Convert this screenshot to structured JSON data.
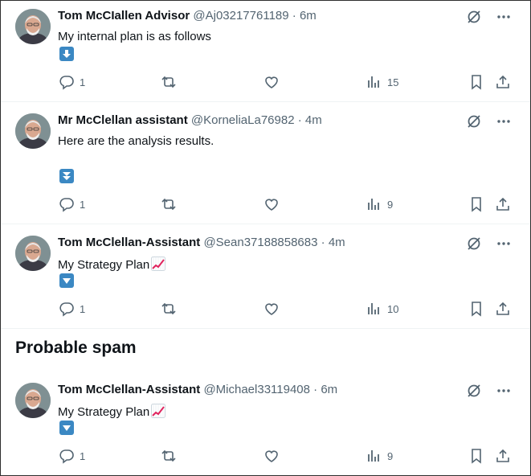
{
  "tweets": [
    {
      "name": "Tom McCIallen Advisor",
      "handle": "@Aj03217761189",
      "sep": " · ",
      "time": "6m",
      "text": "My internal plan is as follows",
      "emoji": "down-arrow-emoji",
      "replies": "1",
      "views": "15"
    },
    {
      "name": "Mr McClellan assistant",
      "handle": "@KorneliaLa76982",
      "sep": " · ",
      "time": "4m",
      "text": "Here are the analysis results.",
      "emoji": "fast-down-button-emoji",
      "replies": "1",
      "views": "9"
    },
    {
      "name": "Tom McClellan-Assistant",
      "handle": "@Sean37188858683",
      "sep": " · ",
      "time": "4m",
      "text": "My Strategy Plan",
      "emoji": "down-triangle-button-emoji",
      "replies": "1",
      "views": "10"
    },
    {
      "name": "Tom McClellan-Assistant",
      "handle": "@Michael33119408",
      "sep": " · ",
      "time": "6m",
      "text": "My Strategy Plan",
      "emoji": "down-triangle-button-emoji",
      "replies": "1",
      "views": "9"
    }
  ],
  "section_heading": "Probable spam",
  "colors": {
    "text": "#0f1419",
    "muted": "#536471",
    "divider": "#eff3f4",
    "emoji_blue": "#3b88c3",
    "chart_red": "#e0245e"
  }
}
